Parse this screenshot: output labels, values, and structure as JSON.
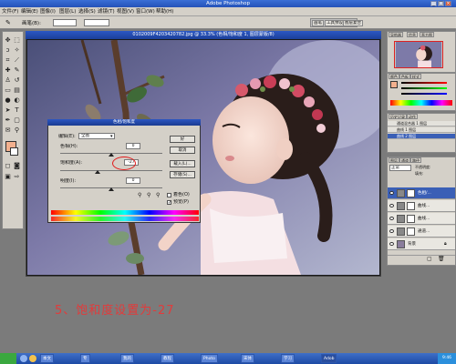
{
  "app": {
    "title": "Adobe Photoshop",
    "colors": {
      "titlebar": "#2452b8",
      "chrome": "#d4d0c8",
      "caption_red": "#e23b3b",
      "circle_red": "#e21a1a"
    }
  },
  "menubar": {
    "items": [
      "文件(F)",
      "编辑(E)",
      "图像(I)",
      "图层(L)",
      "选择(S)",
      "滤镜(T)",
      "视图(V)",
      "窗口(W)",
      "帮助(H)"
    ]
  },
  "options_bar": {
    "brush_label": "画笔(B):",
    "tabs": [
      "画笔",
      "工具预设",
      "图层复合"
    ]
  },
  "document": {
    "title": "0102009F4203420782.jpg @ 33.3% (色相/饱和度 1, 图层蒙版/8)"
  },
  "dialog": {
    "title": "色相/饱和度",
    "edit_label": "编辑(E):",
    "edit_value": "全图",
    "hue_label": "色相(H):",
    "hue_value": "0",
    "hue_level": 0.5,
    "saturation_label": "饱和度(A):",
    "saturation_value": "-27",
    "saturation_level": 0.365,
    "lightness_label": "明度(I):",
    "lightness_value": "0",
    "lightness_level": 0.5,
    "buttons": {
      "ok": "好",
      "cancel": "取消",
      "load": "载入(L)...",
      "save": "存储(S)..."
    },
    "colorize_label": "着色(O)",
    "colorize_checked": false,
    "preview_label": "预览(P)",
    "preview_checked": true
  },
  "right_panels": {
    "navigator_tabs": [
      "导航器",
      "信息",
      "直方图"
    ],
    "color_tabs": [
      "颜色",
      "色板",
      "样式"
    ],
    "history_tabs": [
      "历史记录",
      "动作"
    ],
    "history_items": [
      "通道混合器 1 图层",
      "曲线 1 图层",
      "曲线 2 图层"
    ],
    "layers_tabs": [
      "图层",
      "通道",
      "路径"
    ],
    "blend_mode": "正常",
    "opacity_label": "不透明度:",
    "fill_label": "填充:",
    "layers": [
      "色相/...",
      "曲线...",
      "曲线...",
      "通道...",
      "背景"
    ],
    "selected_layer_index": 0
  },
  "caption": {
    "text": "5、饱和度设置为-27"
  },
  "taskbar": {
    "items": [
      "本文",
      "专",
      "我的",
      "教程",
      "Photo",
      "宋体",
      "学习",
      "Adob"
    ],
    "active_index": 7,
    "clock": "9:46"
  }
}
